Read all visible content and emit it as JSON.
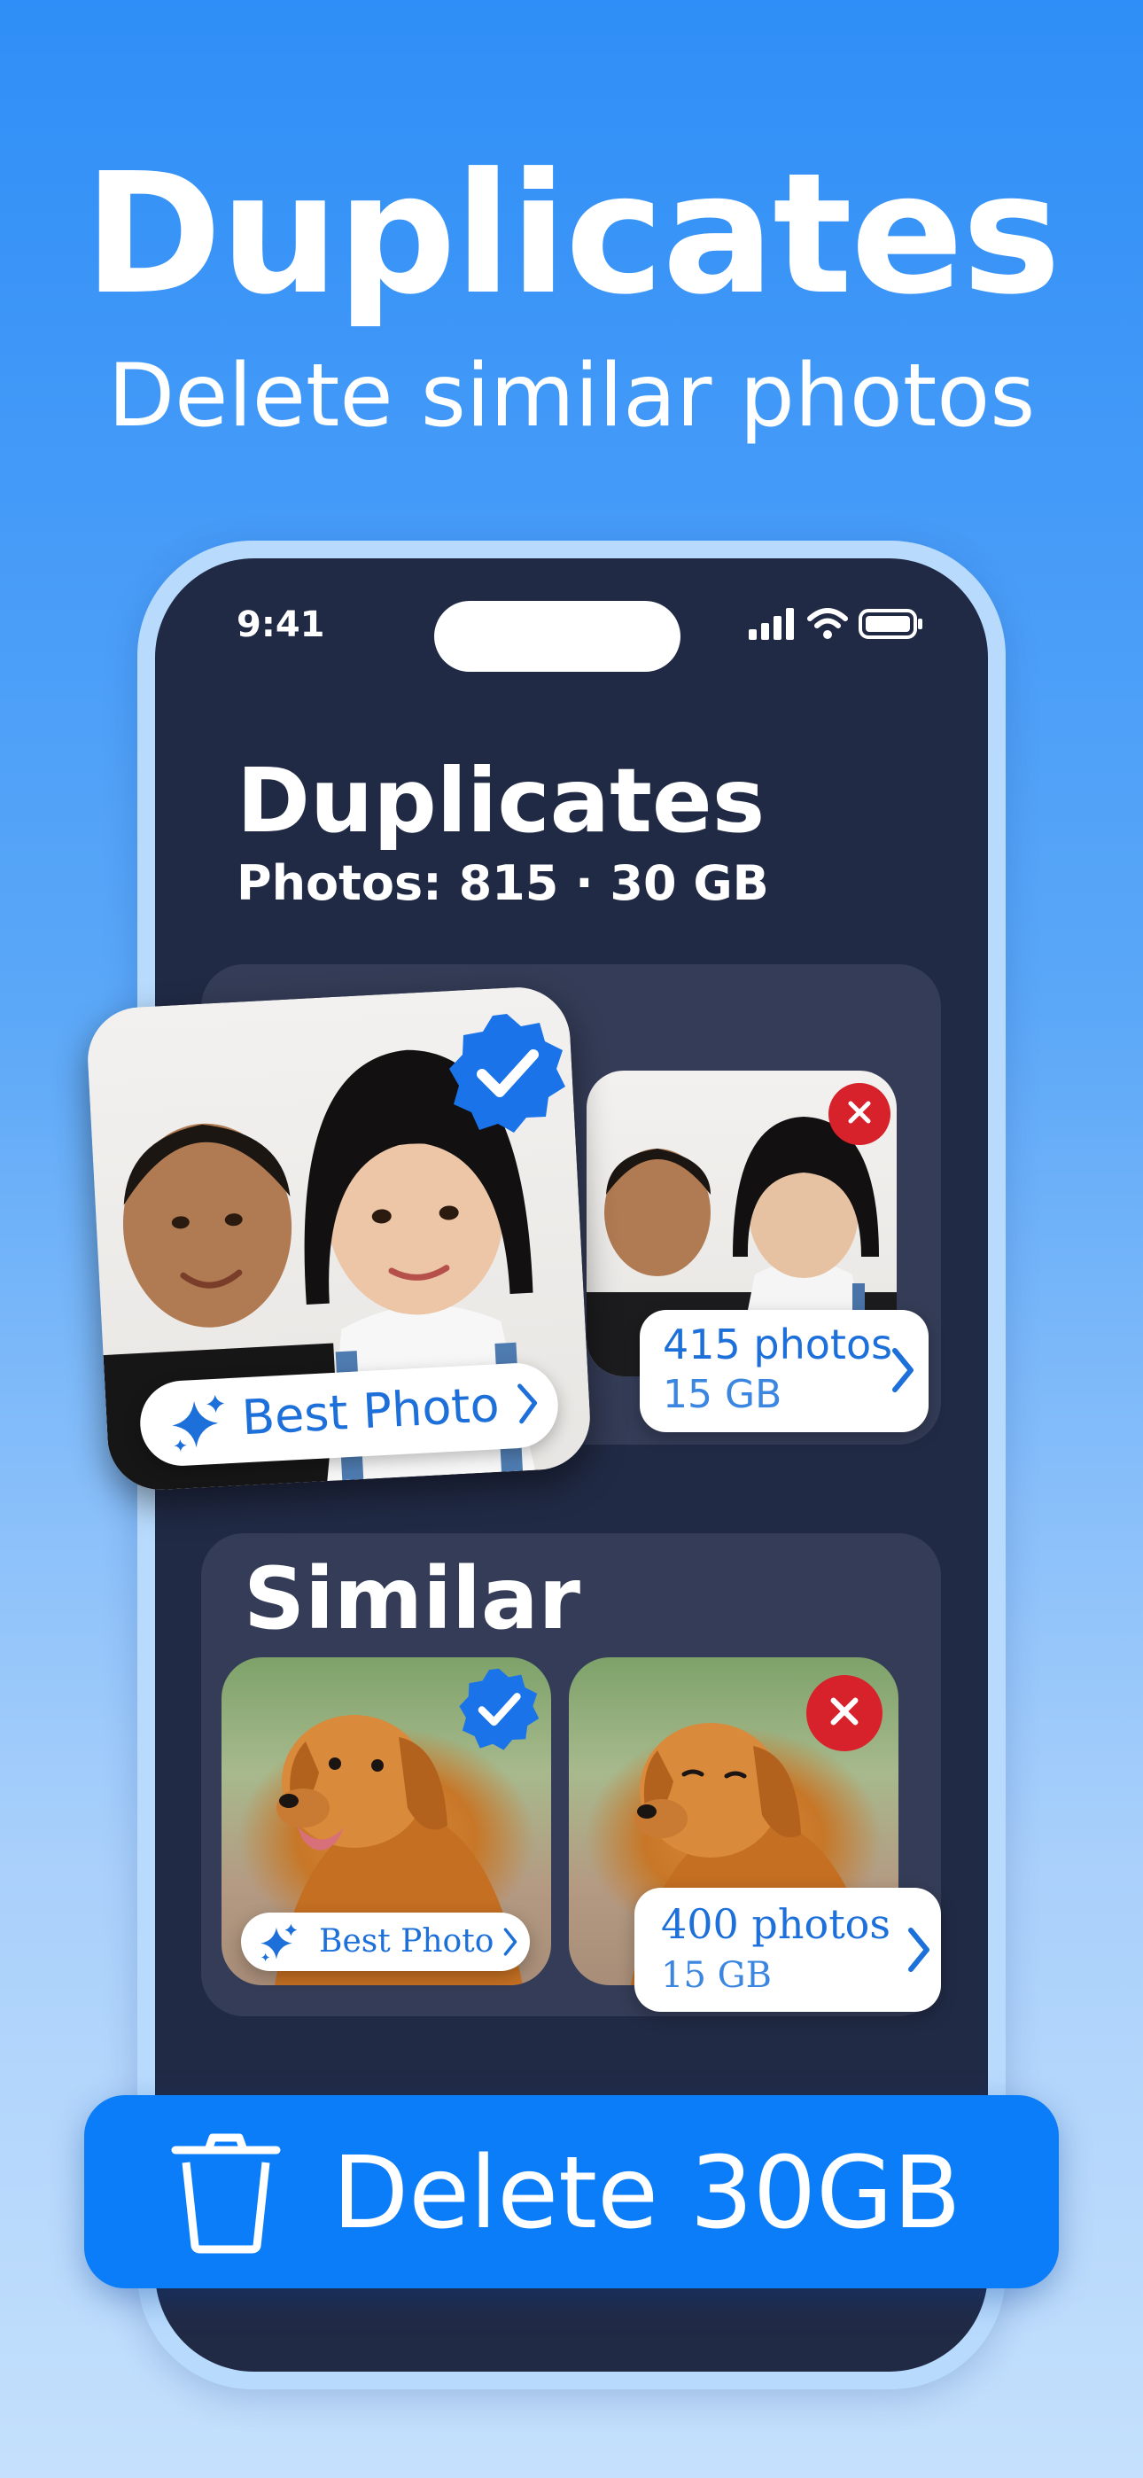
{
  "hero": {
    "title": "Duplicates",
    "subtitle": "Delete similar photos"
  },
  "status_bar": {
    "time": "9:41"
  },
  "screen": {
    "title": "Duplicates",
    "subtitle": "Photos: 815 · 30 GB"
  },
  "duplicates_card": {
    "best_label": "Best Photo",
    "count": "415 photos",
    "size": "15 GB"
  },
  "similar_card": {
    "title": "Similar",
    "best_label": "Best Photo",
    "count": "400 photos",
    "size": "15 GB"
  },
  "delete_button": {
    "label": "Delete 30GB"
  },
  "colors": {
    "accent": "#0b7df8",
    "verified": "#1a73e8",
    "reject": "#d8222b",
    "phone_screen": "#212a45",
    "card": "#343c57"
  },
  "icons": [
    "signal-icon",
    "wifi-icon",
    "battery-icon",
    "verified-check-icon",
    "close-icon",
    "sparkles-icon",
    "chevron-right-icon",
    "trash-icon"
  ]
}
